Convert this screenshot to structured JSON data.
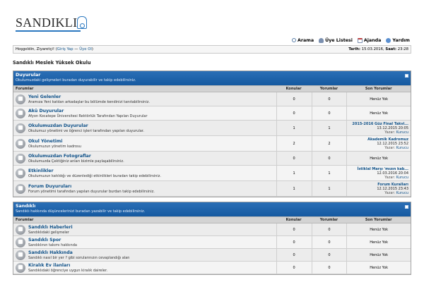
{
  "header": {
    "logo_text": "SANDIKLI",
    "nav": [
      {
        "label": "Arama",
        "icon": "search-icon"
      },
      {
        "label": "Üye Listesi",
        "icon": "users-icon"
      },
      {
        "label": "Ajanda",
        "icon": "calendar-icon"
      },
      {
        "label": "Yardım",
        "icon": "help-icon"
      }
    ]
  },
  "infobar": {
    "welcome": "Hoşgeldin, Ziyaretçi!",
    "open_paren": "(",
    "login": "Giriş Yap",
    "sep": " — ",
    "register": "Üye Ol",
    "close_paren": ")",
    "date_label": "Tarih:",
    "date_value": "15.03.2016,",
    "time_label": "Saat:",
    "time_value": "23:28"
  },
  "site_title": "Sandıklı Meslek Yüksek Okulu",
  "columns": {
    "forum": "Forumlar",
    "topics": "Konular",
    "posts": "Yorumlar",
    "last": "Son Yorumlar"
  },
  "categories": [
    {
      "title": "Duyurular",
      "desc": "Okulumuzdaki gelişmeleri buradan duyurabilir ve takip edebilirsiniz.",
      "forums": [
        {
          "name": "Yeni Gelenler",
          "desc": "Aramıza Yeni katılan arkadaşlar bu bölümde kendinizi tanıtabilirsiniz.",
          "topics": "0",
          "posts": "0",
          "last": {
            "none": "Henüz Yok"
          }
        },
        {
          "name": "Akü Duyurular",
          "desc": "Afyon Kocatepe Üniversitesi Rektörlük Tarafından Yapılan Duyurular",
          "topics": "0",
          "posts": "0",
          "last": {
            "none": "Henüz Yok"
          }
        },
        {
          "name": "Okulumuzdan Duyurular",
          "desc": "Okulumuz yönetimi ve öğrenci işleri tarafından yapılan duyurular.",
          "topics": "1",
          "posts": "1",
          "last": {
            "title": "2015-2016 Güz Final Takvi...",
            "date": "13.12.2015 20:05",
            "by_label": "Yazar:",
            "by": "Kurucu"
          }
        },
        {
          "name": "Okul Yönetimi",
          "desc": "Okulumuzun yönetim kadrosu",
          "topics": "2",
          "posts": "2",
          "last": {
            "title": "Akademik Kadromuz",
            "date": "12.12.2015 23:52",
            "by_label": "Yazar:",
            "by": "Kurucu"
          }
        },
        {
          "name": "Okulumuzdan Fotograflar",
          "desc": "Okulumuzda Çektiğiniz anları bizimle paylaşabilirsiniz.",
          "topics": "0",
          "posts": "0",
          "last": {
            "none": "Henüz Yok"
          }
        },
        {
          "name": "Etkinlikler",
          "desc": "Okulumuzun katıldığı ve düzenlediği etkinlikleri buradan takip edebilirsiniz.",
          "topics": "1",
          "posts": "1",
          "last": {
            "title": "İstiklal Marşı 'mızın kab...",
            "date": "12.03.2016 20:04",
            "by_label": "Yazar:",
            "by": "Kurucu"
          }
        },
        {
          "name": "Forum Duyuruları",
          "desc": "Forum yönetimi tarafından yapılan duyurular burdan takip edebilirsiniz.",
          "topics": "1",
          "posts": "1",
          "last": {
            "title": "Forum Kuralları",
            "date": "12.12.2015 23:43",
            "by_label": "Yazar:",
            "by": "Kurucu"
          }
        }
      ]
    },
    {
      "title": "Sandıklı",
      "desc": "Sandıklı hakkında düşüncelerinizi buradan yazabilir ve takip edebilirsiniz.",
      "forums": [
        {
          "name": "Sandıklı Haberleri",
          "desc": "Sandıklıdaki gelişmeler",
          "topics": "0",
          "posts": "0",
          "last": {
            "none": "Henüz Yok"
          }
        },
        {
          "name": "Sandıklı Spor",
          "desc": "Sandıklının takımı hakkında",
          "topics": "0",
          "posts": "0",
          "last": {
            "none": "Henüz Yok"
          }
        },
        {
          "name": "Sandıklı Hakkında",
          "desc": "Sandıklı nasıl bir yer ? gibi sorularınızın cevaplandığı alan",
          "topics": "0",
          "posts": "0",
          "last": {
            "none": "Henüz Yok"
          }
        },
        {
          "name": "Kiralık Ev ilanları",
          "desc": "Sandıklıdaki öğrenciye uygun kiralık daireler.",
          "topics": "0",
          "posts": "0",
          "last": {
            "none": "Henüz Yok"
          }
        }
      ]
    }
  ]
}
